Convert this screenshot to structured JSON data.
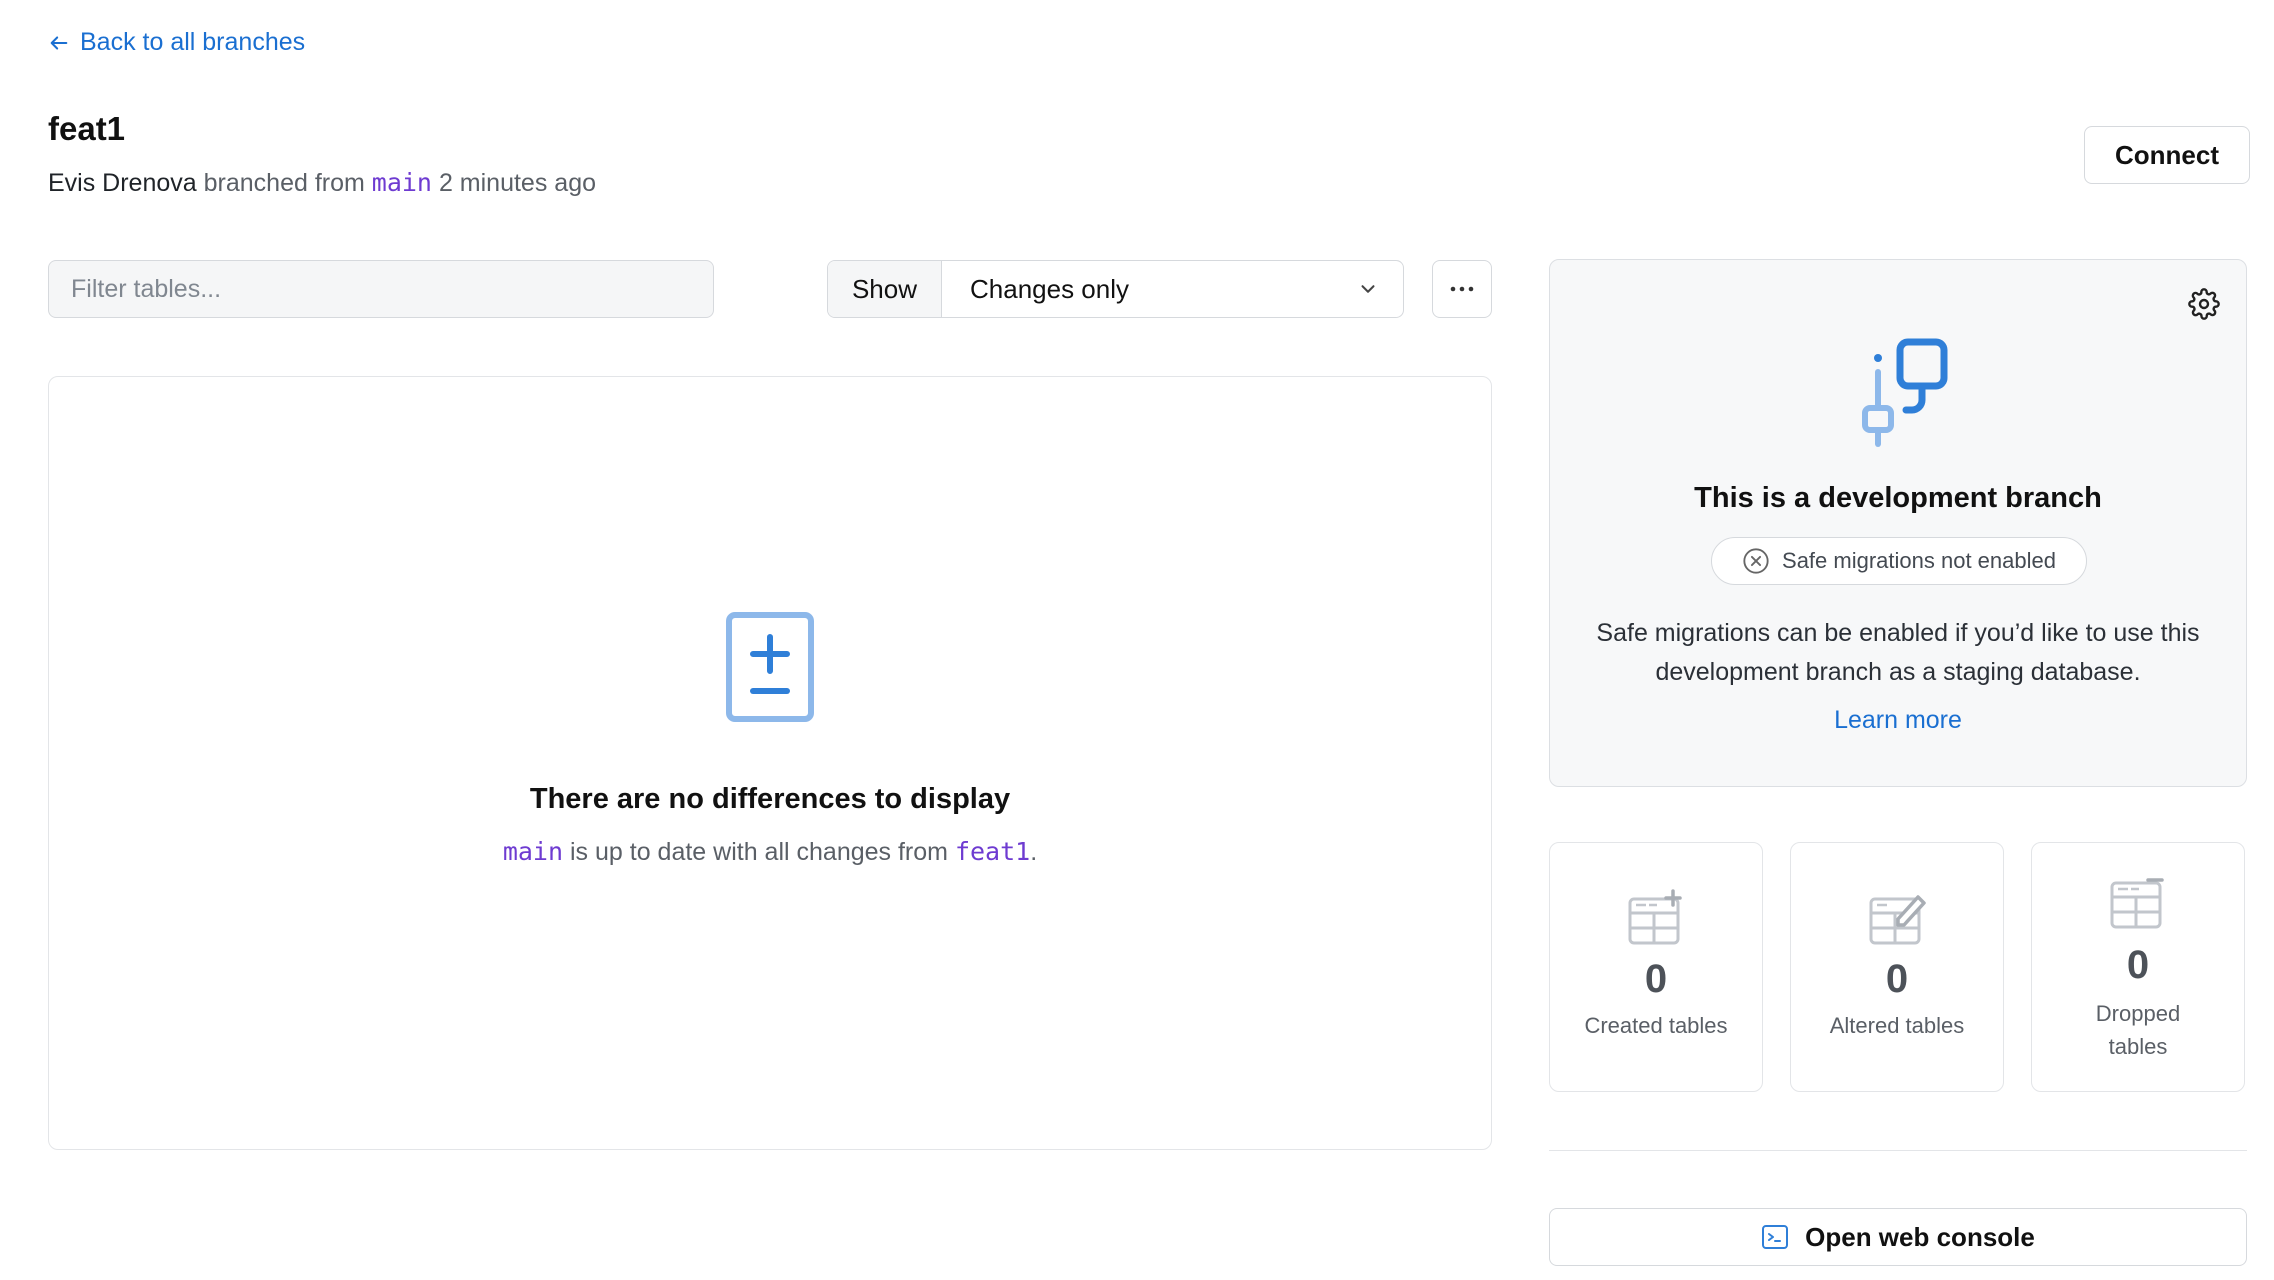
{
  "nav": {
    "back_label": "Back to all branches"
  },
  "branch": {
    "name": "feat1",
    "author": "Evis Drenova",
    "branched_from_text": "branched from",
    "parent": "main",
    "time_ago": "2 minutes ago"
  },
  "actions": {
    "connect_label": "Connect",
    "console_label": "Open web console"
  },
  "filter": {
    "placeholder": "Filter tables..."
  },
  "show": {
    "label": "Show",
    "selected": "Changes only"
  },
  "empty_state": {
    "title": "There are no differences to display",
    "target": "main",
    "middle_text": "is up to date with all changes from",
    "source": "feat1",
    "end": "."
  },
  "dev_card": {
    "title": "This is a development branch",
    "badge": "Safe migrations not enabled",
    "description": "Safe migrations can be enabled if you’d like to use this development branch as a staging database.",
    "learn_more": "Learn more"
  },
  "stats": [
    {
      "count": "0",
      "label": "Created tables"
    },
    {
      "count": "0",
      "label": "Altered tables"
    },
    {
      "count": "0",
      "label": "Dropped tables"
    }
  ],
  "colors": {
    "link": "#1a6fd1",
    "code": "#6e3bd1",
    "icon_blue": "#2f7fd8",
    "icon_light": "#8db8ea"
  }
}
